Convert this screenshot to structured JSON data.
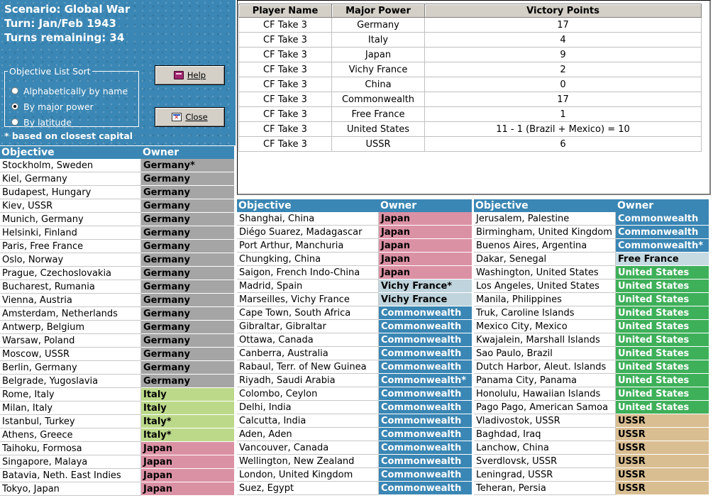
{
  "scenario": {
    "name": "Scenario: Global War",
    "turn": "Turn: Jan/Feb 1943",
    "remaining": "Turns remaining: 34"
  },
  "sort": {
    "legend": "Objective List Sort",
    "options": [
      "Alphabetically by name",
      "By major power",
      "By latitude"
    ],
    "selected": "By major power"
  },
  "buttons": {
    "help": "Help",
    "close": "Close"
  },
  "note": "* based on closest capital",
  "player_table": {
    "headers": [
      "Player Name",
      "Major Power",
      "Victory Points"
    ],
    "rows": [
      [
        "CF Take 3",
        "Germany",
        "17"
      ],
      [
        "CF Take 3",
        "Italy",
        "4"
      ],
      [
        "CF Take 3",
        "Japan",
        "9"
      ],
      [
        "CF Take 3",
        "Vichy France",
        "2"
      ],
      [
        "CF Take 3",
        "China",
        "0"
      ],
      [
        "CF Take 3",
        "Commonwealth",
        "17"
      ],
      [
        "CF Take 3",
        "Free France",
        "1"
      ],
      [
        "CF Take 3",
        "United States",
        "11 - 1 (Brazil + Mexico) = 10"
      ],
      [
        "CF Take 3",
        "USSR",
        "6"
      ]
    ]
  },
  "objective_headers": {
    "objective": "Objective",
    "owner": "Owner"
  },
  "colors": {
    "Germany": "#a5a5a5",
    "Italy": "#bcd98a",
    "Japan": "#db91a4",
    "Vichy France": "#bfd4dc",
    "Commonwealth": "#3a86b4",
    "Free France": "#c6dae2",
    "United States": "#3fb05a",
    "USSR": "#d9be92"
  },
  "panels": [
    [
      [
        "Stockholm, Sweden",
        "Germany*"
      ],
      [
        "Kiel, Germany",
        "Germany"
      ],
      [
        "Budapest, Hungary",
        "Germany"
      ],
      [
        "Kiev, USSR",
        "Germany"
      ],
      [
        "Munich, Germany",
        "Germany"
      ],
      [
        "Helsinki, Finland",
        "Germany"
      ],
      [
        "Paris, Free France",
        "Germany"
      ],
      [
        "Oslo, Norway",
        "Germany"
      ],
      [
        "Prague, Czechoslovakia",
        "Germany"
      ],
      [
        "Bucharest, Rumania",
        "Germany"
      ],
      [
        "Vienna, Austria",
        "Germany"
      ],
      [
        "Amsterdam, Netherlands",
        "Germany"
      ],
      [
        "Antwerp, Belgium",
        "Germany"
      ],
      [
        "Warsaw, Poland",
        "Germany"
      ],
      [
        "Moscow, USSR",
        "Germany"
      ],
      [
        "Berlin, Germany",
        "Germany"
      ],
      [
        "Belgrade, Yugoslavia",
        "Germany"
      ],
      [
        "Rome, Italy",
        "Italy"
      ],
      [
        "Milan, Italy",
        "Italy"
      ],
      [
        "Istanbul, Turkey",
        "Italy*"
      ],
      [
        "Athens, Greece",
        "Italy*"
      ],
      [
        "Taihoku, Formosa",
        "Japan"
      ],
      [
        "Singapore, Malaya",
        "Japan"
      ],
      [
        "Batavia, Neth. East Indies",
        "Japan"
      ],
      [
        "Tokyo, Japan",
        "Japan"
      ]
    ],
    [
      [
        "Shanghai, China",
        "Japan"
      ],
      [
        "Diégo Suarez, Madagascar",
        "Japan"
      ],
      [
        "Port Arthur, Manchuria",
        "Japan"
      ],
      [
        "Chungking, China",
        "Japan"
      ],
      [
        "Saigon, French Indo-China",
        "Japan"
      ],
      [
        "Madrid, Spain",
        "Vichy France*"
      ],
      [
        "Marseilles, Vichy France",
        "Vichy France"
      ],
      [
        "Cape Town, South Africa",
        "Commonwealth"
      ],
      [
        "Gibraltar, Gibraltar",
        "Commonwealth"
      ],
      [
        "Ottawa, Canada",
        "Commonwealth"
      ],
      [
        "Canberra, Australia",
        "Commonwealth"
      ],
      [
        "Rabaul, Terr. of New Guinea",
        "Commonwealth"
      ],
      [
        "Riyadh, Saudi Arabia",
        "Commonwealth*"
      ],
      [
        "Colombo, Ceylon",
        "Commonwealth"
      ],
      [
        "Delhi, India",
        "Commonwealth"
      ],
      [
        "Calcutta, India",
        "Commonwealth"
      ],
      [
        "Aden, Aden",
        "Commonwealth"
      ],
      [
        "Vancouver, Canada",
        "Commonwealth"
      ],
      [
        "Wellington, New Zealand",
        "Commonwealth"
      ],
      [
        "London, United Kingdom",
        "Commonwealth"
      ],
      [
        "Suez, Egypt",
        "Commonwealth"
      ]
    ],
    [
      [
        "Jerusalem, Palestine",
        "Commonwealth"
      ],
      [
        "Birmingham, United Kingdom",
        "Commonwealth"
      ],
      [
        "Buenos Aires, Argentina",
        "Commonwealth*"
      ],
      [
        "Dakar, Senegal",
        "Free France"
      ],
      [
        "Washington, United States",
        "United States"
      ],
      [
        "Los Angeles, United States",
        "United States"
      ],
      [
        "Manila, Philippines",
        "United States"
      ],
      [
        "Truk, Caroline Islands",
        "United States"
      ],
      [
        "Mexico City, Mexico",
        "United States"
      ],
      [
        "Kwajalein, Marshall Islands",
        "United States"
      ],
      [
        "Sao Paulo, Brazil",
        "United States"
      ],
      [
        "Dutch Harbor, Aleut. Islands",
        "United States"
      ],
      [
        "Panama City, Panama",
        "United States"
      ],
      [
        "Honolulu, Hawaiian Islands",
        "United States"
      ],
      [
        "Pago Pago, American Samoa",
        "United States"
      ],
      [
        "Vladivostok, USSR",
        "USSR"
      ],
      [
        "Baghdad, Iraq",
        "USSR"
      ],
      [
        "Lanchow, China",
        "USSR"
      ],
      [
        "Sverdlovsk, USSR",
        "USSR"
      ],
      [
        "Leningrad, USSR",
        "USSR"
      ],
      [
        "Teheran, Persia",
        "USSR"
      ]
    ]
  ]
}
